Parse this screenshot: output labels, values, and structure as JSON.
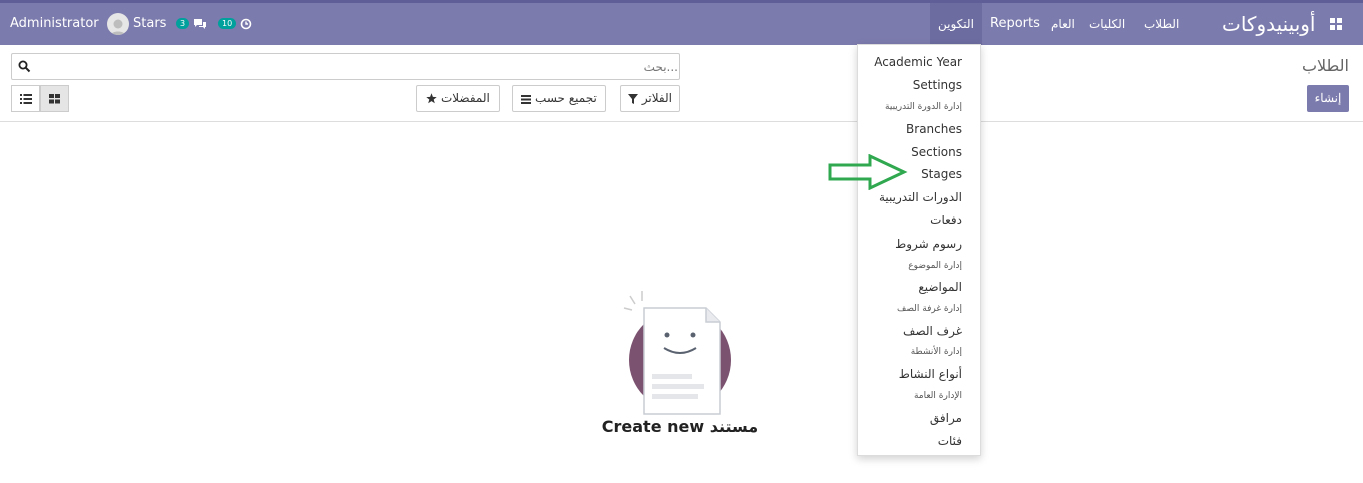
{
  "navbar": {
    "brand": "أوبينيدوكات",
    "menus": [
      {
        "label": "الطلاب"
      },
      {
        "label": "الكليات"
      },
      {
        "label": "العام"
      },
      {
        "label": "Reports"
      },
      {
        "label": "التكوين",
        "active": true
      }
    ],
    "stars_label": "Stars",
    "chat_count": "3",
    "activity_count": "10",
    "user_name": "Administrator",
    "accent_color": "#7c7bad"
  },
  "control_panel": {
    "title": "الطلاب",
    "create_label": "إنشاء",
    "search_placeholder": "بحث...",
    "filters_label": "الفلاتر",
    "group_by_label": "تجميع حسب",
    "favorites_label": "المفضلات"
  },
  "config_menu": {
    "items": [
      {
        "label": "Academic Year",
        "type": "item"
      },
      {
        "label": "Settings",
        "type": "item"
      },
      {
        "label": "إدارة الدورة التدريبية",
        "type": "header"
      },
      {
        "label": "Branches",
        "type": "item"
      },
      {
        "label": "Sections",
        "type": "item"
      },
      {
        "label": "Stages",
        "type": "item"
      },
      {
        "label": "الدورات التدريبية",
        "type": "item"
      },
      {
        "label": "دفعات",
        "type": "item"
      },
      {
        "label": "رسوم شروط",
        "type": "item"
      },
      {
        "label": "إدارة الموضوع",
        "type": "header"
      },
      {
        "label": "المواضيع",
        "type": "item"
      },
      {
        "label": "إدارة غرفة الصف",
        "type": "header"
      },
      {
        "label": "غرف الصف",
        "type": "item"
      },
      {
        "label": "إدارة الأنشطة",
        "type": "header"
      },
      {
        "label": "أنواع النشاط",
        "type": "item"
      },
      {
        "label": "الإدارة العامة",
        "type": "header"
      },
      {
        "label": "مرافق",
        "type": "item"
      },
      {
        "label": "فئات",
        "type": "item"
      }
    ]
  },
  "empty_state": {
    "message": "Create new مستند"
  }
}
